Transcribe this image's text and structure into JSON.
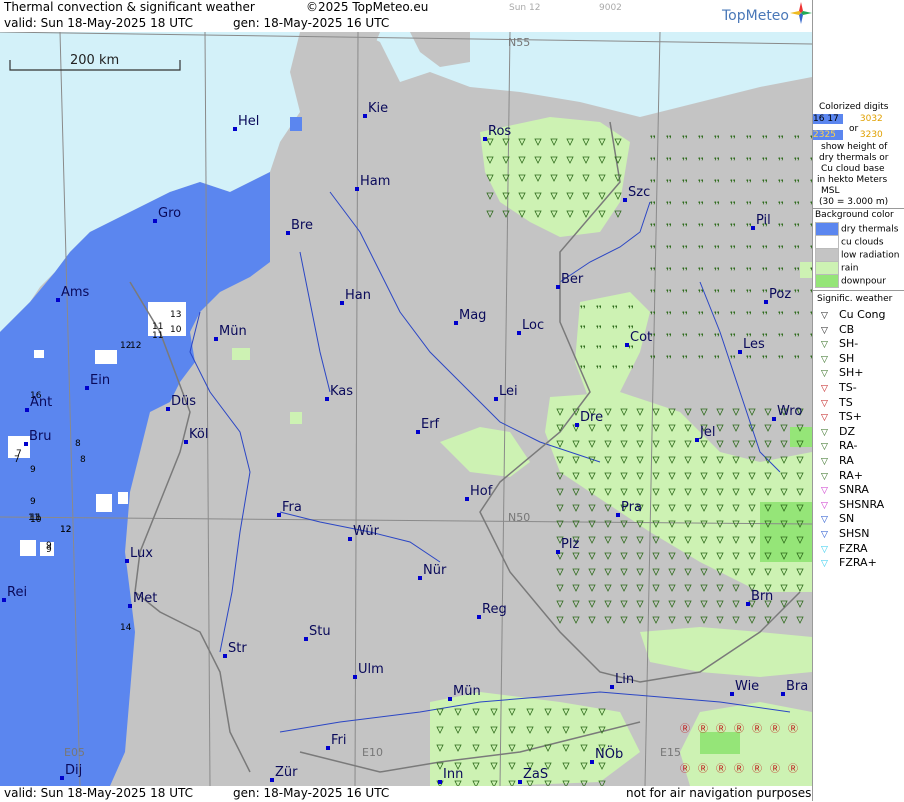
{
  "header": {
    "title": "Thermal convection & significant weather",
    "copyright": "©2025 TopMeteo.eu",
    "sun": "Sun 12",
    "code": "9002",
    "valid": "valid:  Sun  18-May-2025  18 UTC",
    "gen": "gen: 18-May-2025 16 UTC",
    "logo": "TopMeteo"
  },
  "footer": {
    "valid": "valid:  Sun  18-May-2025  18 UTC",
    "gen": "gen: 18-May-2025 16 UTC",
    "note": "not for air navigation purposes"
  },
  "map": {
    "scale_label": "200 km",
    "grid_labels": [
      "N55",
      "N50",
      "E05",
      "E10",
      "E15"
    ],
    "cities": [
      "Hel",
      "Kie",
      "Ros",
      "Ham",
      "Gro",
      "Szc",
      "Bre",
      "Pil",
      "Ams",
      "Han",
      "Ber",
      "Poz",
      "Mün",
      "Mag",
      "Loc",
      "Cot",
      "Les",
      "Ein",
      "Kas",
      "Lei",
      "Ant",
      "Düs",
      "Dre",
      "Wro",
      "Bru",
      "Köl",
      "Erf",
      "Jel",
      "Hof",
      "Fra",
      "Pra",
      "Lux",
      "Wür",
      "Plz",
      "Rei",
      "Met",
      "Nür",
      "Brn",
      "Reg",
      "Str",
      "Stu",
      "Ulm",
      "Lin",
      "Wie",
      "Bra",
      "Mün",
      "Fri",
      "NÖb",
      "Zür",
      "Dij",
      "Inn",
      "ZaS"
    ],
    "digits": [
      "13",
      "11",
      "12",
      "10",
      "11",
      "12",
      "12",
      "7",
      "16",
      "8",
      "9",
      "7",
      "8",
      "9",
      "9",
      "10",
      "11",
      "12",
      "9",
      "11",
      "14"
    ]
  },
  "legend": {
    "colorized_title": "Colorized digits",
    "digit_samples": [
      "16 17",
      "3032",
      "or",
      "2325",
      "3230"
    ],
    "desc": [
      "show height of",
      "dry thermals or",
      "Cu cloud base",
      "in hekto Meters",
      "MSL",
      "(30 = 3.000 m)"
    ],
    "bg_title": "Background color",
    "bg_items": [
      {
        "label": "dry thermals",
        "color": "#5b86ef"
      },
      {
        "label": "cu clouds",
        "color": "#ffffff"
      },
      {
        "label": "low radiation",
        "color": "#c4c4c4"
      },
      {
        "label": "rain",
        "color": "#cdf2b3"
      },
      {
        "label": "downpour",
        "color": "#95e578"
      }
    ],
    "wx_title": "Signific. weather",
    "wx_items": [
      "Cu Cong",
      "CB",
      "SH-",
      "SH",
      "SH+",
      "TS-",
      "TS",
      "TS+",
      "DZ",
      "RA-",
      "RA",
      "RA+",
      "SNRA",
      "SHSNRA",
      "SN",
      "SHSN",
      "FZRA",
      "FZRA+"
    ]
  },
  "colors": {
    "sea": "#d3f1f9",
    "land": "#c4c4c4",
    "dry": "#5b86ef",
    "cu": "#ffffff",
    "rain": "#cdf2b3",
    "downpour": "#95e578",
    "river": "#2b46c4",
    "border": "#7a7a7a"
  }
}
